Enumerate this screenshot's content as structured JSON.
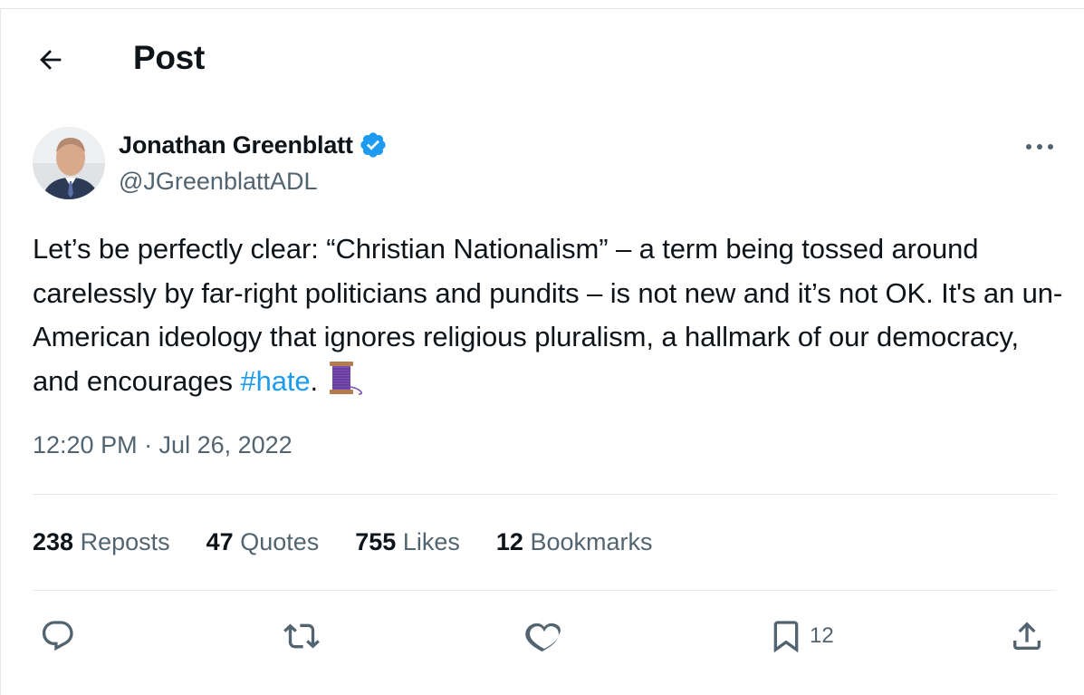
{
  "header": {
    "title": "Post",
    "back_icon": "arrow-left-icon"
  },
  "author": {
    "name": "Jonathan Greenblatt",
    "handle": "@JGreenblattADL",
    "verified": true,
    "verified_color": "#1d9bf0"
  },
  "tweet": {
    "text_before_hashtag": "Let’s be perfectly clear: “Christian Nationalism” – a term being tossed around carelessly by far-right politicians and pundits – is not new and it’s not OK. It's an un-American ideology that ignores religious pluralism, a hallmark of our democracy, and encourages ",
    "hashtag": "#hate",
    "text_after_hashtag": ". ",
    "emoji": "spool-of-thread-icon",
    "hashtag_color": "#1d9bf0"
  },
  "timestamp": "12:20 PM · Jul 26, 2022",
  "stats": {
    "reposts_count": "238",
    "reposts_label": "Reposts",
    "quotes_count": "47",
    "quotes_label": "Quotes",
    "likes_count": "755",
    "likes_label": "Likes",
    "bookmarks_count": "12",
    "bookmarks_label": "Bookmarks"
  },
  "actions": {
    "reply_icon": "reply-icon",
    "repost_icon": "repost-icon",
    "like_icon": "heart-icon",
    "bookmark_icon": "bookmark-icon",
    "bookmark_count": "12",
    "share_icon": "share-icon"
  }
}
